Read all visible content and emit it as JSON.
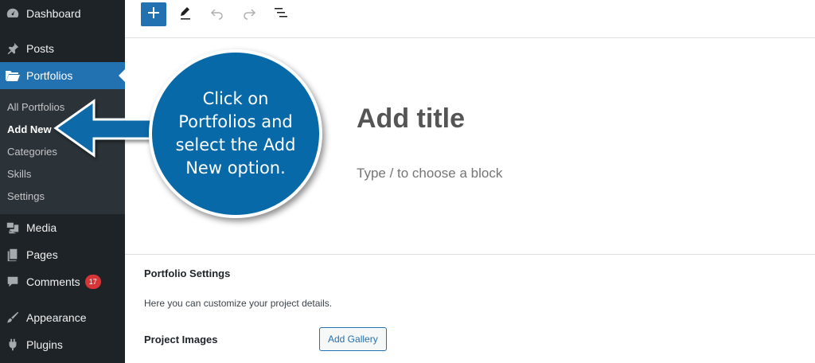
{
  "sidebar": {
    "items": [
      {
        "label": "Dashboard",
        "icon": "dashboard-icon"
      },
      {
        "label": "Posts",
        "icon": "pin-icon"
      },
      {
        "label": "Portfolios",
        "icon": "folder-icon",
        "active": true
      },
      {
        "label": "Media",
        "icon": "media-icon"
      },
      {
        "label": "Pages",
        "icon": "pages-icon"
      },
      {
        "label": "Comments",
        "icon": "comment-icon",
        "badge": "17"
      },
      {
        "label": "Appearance",
        "icon": "brush-icon"
      },
      {
        "label": "Plugins",
        "icon": "plugin-icon"
      }
    ],
    "submenu": [
      "All Portfolios",
      "Add New",
      "Categories",
      "Skills",
      "Settings"
    ],
    "current_submenu": "Add New"
  },
  "toolbar": {
    "buttons": [
      "add-block-icon",
      "pencil-icon",
      "undo-icon",
      "redo-icon",
      "list-view-icon"
    ]
  },
  "editor": {
    "title_placeholder": "Add title",
    "block_placeholder": "Type / to choose a block"
  },
  "metabox": {
    "heading": "Portfolio Settings",
    "description": "Here you can customize your project details.",
    "field_label": "Project Images",
    "button_label": "Add Gallery"
  },
  "annotation": {
    "text": "Click on Portfolios and select the Add New option."
  },
  "colors": {
    "sidebar_bg": "#1d2327",
    "submenu_bg": "#2c3338",
    "accent": "#2271b1",
    "badge": "#d63638",
    "callout": "#0769a8"
  }
}
